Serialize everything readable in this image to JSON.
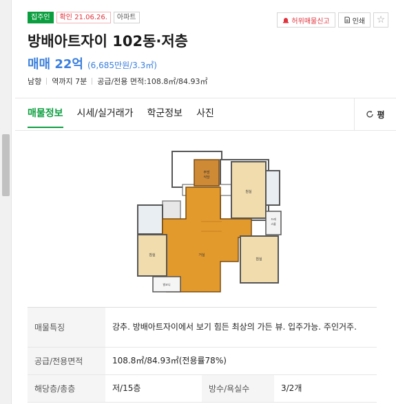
{
  "badges": {
    "owner": "집주인",
    "confirm": "확인 21.06.26.",
    "type": "아파트"
  },
  "actions": {
    "report": "허위매물신고",
    "print": "인쇄",
    "favorite_icon": "star-icon"
  },
  "listing": {
    "title": "방배아트자이 102동·저층",
    "price": "매매 22억",
    "price_per_area": "(6,685만원/3.3㎡)",
    "direction": "남향",
    "station": "역까지 7분",
    "area_info": "공급/전용 면적:108.8㎡/84.93㎡"
  },
  "tabs": [
    {
      "label": "매물정보",
      "active": true
    },
    {
      "label": "시세/실거래가",
      "active": false
    },
    {
      "label": "학군정보",
      "active": false
    },
    {
      "label": "사진",
      "active": false
    }
  ],
  "area_toggle": {
    "label": "평",
    "icon": "refresh-icon"
  },
  "floor_plan": {
    "rooms": {
      "kitchen": "주방\n식당",
      "bedroom1": "침실",
      "bedroom2": "침실",
      "bedroom3": "침실",
      "living": "거실",
      "dress": "드레\n스룸",
      "balcony": "발코니"
    }
  },
  "table": {
    "features_label": "매물특징",
    "features_value": "강추. 방배아트자이에서 보기 힘든 최상의 가든 뷰. 입주가능. 주인거주.",
    "area_label": "공급/전용면적",
    "area_value": "108.8㎡/84.93㎡(전용률78%)",
    "floor_label": "해당층/총층",
    "floor_value": "저/15층",
    "rooms_label": "방수/욕실수",
    "rooms_value": "3/2개"
  },
  "colors": {
    "accent_green": "#0b9e3f",
    "price_blue": "#3a7fdd",
    "alert_red": "#e0323c"
  }
}
